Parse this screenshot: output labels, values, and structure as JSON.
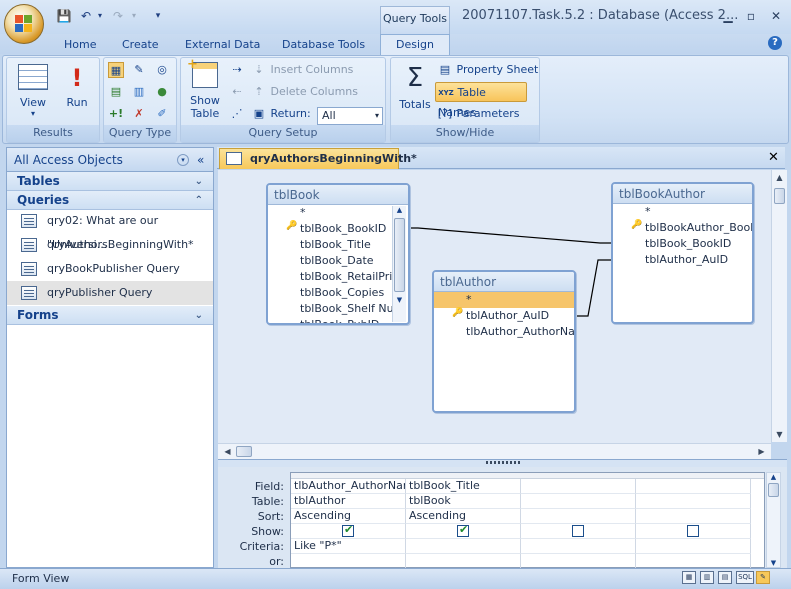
{
  "titlebar": {
    "contextual_tab": "Query Tools",
    "title": "20071107.Task.5.2 : Database (Access 2...",
    "minimize_icon": "minimize-icon",
    "maximize_icon": "maximize-icon",
    "close_icon": "close-icon"
  },
  "ribbon_tabs": [
    "Home",
    "Create",
    "External Data",
    "Database Tools",
    "Design"
  ],
  "groups": {
    "results": {
      "label": "Results",
      "view": "View",
      "run": "Run"
    },
    "query_type": {
      "label": "Query Type"
    },
    "query_setup": {
      "label": "Query Setup",
      "show_table_l1": "Show",
      "show_table_l2": "Table",
      "insert_columns": "Insert Columns",
      "delete_columns": "Delete Columns",
      "return_label": "Return:",
      "return_value": "All"
    },
    "show_hide": {
      "label": "Show/Hide",
      "totals": "Totals",
      "property_sheet": "Property Sheet",
      "table_names": "Table Names",
      "parameters": "Parameters"
    }
  },
  "navpane": {
    "header": "All Access Objects",
    "sections": {
      "tables": "Tables",
      "queries": "Queries",
      "forms": "Forms"
    },
    "queries": [
      "qry02: What are our \"Universi...",
      "qryAuthorsBeginningWith*",
      "qryBookPublisher Query",
      "qryPublisher Query"
    ]
  },
  "document": {
    "tab_title": "qryAuthorsBeginningWith*"
  },
  "tables": {
    "tblBook": {
      "title": "tblBook",
      "fields": [
        "*",
        "tblBook_BookID",
        "tblBook_Title",
        "tblBook_Date",
        "tblBook_RetailPri",
        "tblBook_Copies",
        "tblBook_Shelf Nu",
        "tblBook_PubID"
      ]
    },
    "tblAuthor": {
      "title": "tblAuthor",
      "fields": [
        "*",
        "tblAuthor_AuID",
        "tlbAuthor_AuthorNa"
      ]
    },
    "tblBookAuthor": {
      "title": "tblBookAuthor",
      "fields": [
        "*",
        "tblBookAuthor_Book",
        "tblBook_BookID",
        "tblAuthor_AuID"
      ]
    }
  },
  "grid": {
    "row_labels": [
      "Field:",
      "Table:",
      "Sort:",
      "Show:",
      "Criteria:",
      "or:"
    ],
    "columns": [
      {
        "field": "tlbAuthor_AuthorNam",
        "table": "tblAuthor",
        "sort": "Ascending",
        "show": true,
        "criteria": "Like \"P*\""
      },
      {
        "field": "tblBook_Title",
        "table": "tblBook",
        "sort": "Ascending",
        "show": true,
        "criteria": ""
      },
      {
        "field": "",
        "table": "",
        "sort": "",
        "show": false,
        "criteria": ""
      },
      {
        "field": "",
        "table": "",
        "sort": "",
        "show": false,
        "criteria": ""
      }
    ]
  },
  "status": {
    "text": "Form View",
    "sql_label": "SQL"
  }
}
